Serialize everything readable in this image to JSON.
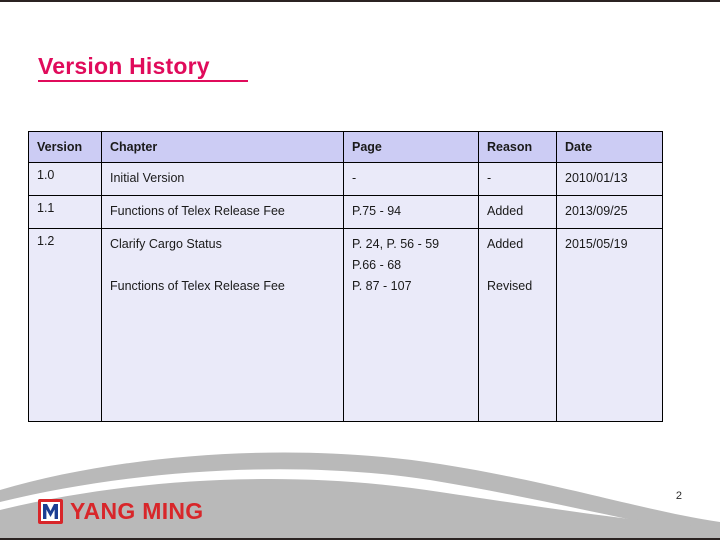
{
  "slide": {
    "title": "Version History",
    "page_number": "2",
    "accent_color": "#e00b5b",
    "header_bg_color": "#ccccf4",
    "cell_bg_color": "#eaeaf9",
    "footer_wave_color": "#b9b9b9",
    "logo_color": "#d8262a"
  },
  "table": {
    "columns": [
      "Version",
      "Chapter",
      "Page",
      "Reason",
      "Date"
    ],
    "rows": [
      {
        "version": "1.0",
        "chapter": [
          "Initial Version"
        ],
        "page": [
          "-"
        ],
        "reason": [
          "-"
        ],
        "date": [
          "2010/01/13"
        ]
      },
      {
        "version": "1.1",
        "chapter": [
          "Functions of Telex Release Fee"
        ],
        "page": [
          "P.75 - 94"
        ],
        "reason": [
          "Added"
        ],
        "date": [
          "2013/09/25"
        ]
      },
      {
        "version": "1.2",
        "chapter": [
          "Clarify Cargo Status",
          "",
          "Functions of Telex Release Fee"
        ],
        "page": [
          "P. 24, P. 56 - 59",
          "P.66 - 68",
          "P. 87 - 107"
        ],
        "reason": [
          "Added",
          "",
          "Revised"
        ],
        "date": [
          "2015/05/19",
          "",
          ""
        ]
      }
    ]
  },
  "footer": {
    "logo_text": "YANG MING",
    "logo_mark": "yang-ming-m-mark"
  }
}
